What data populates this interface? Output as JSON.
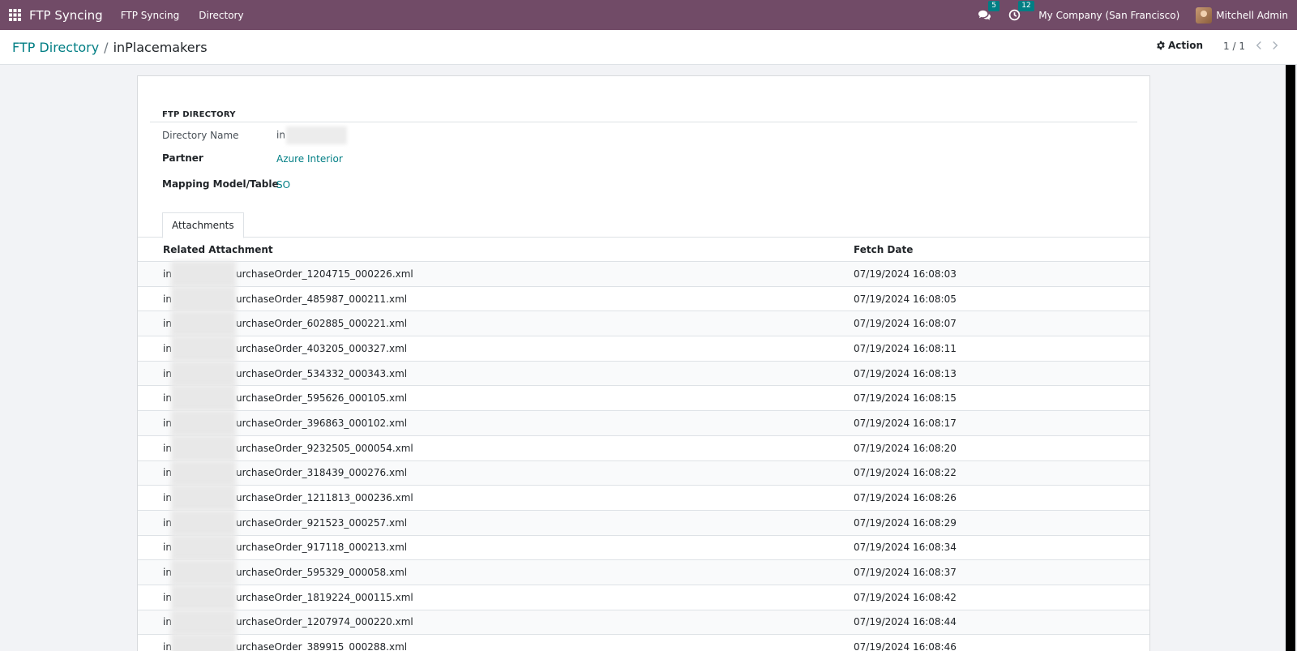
{
  "navbar": {
    "app_title": "FTP Syncing",
    "menu": [
      "FTP Syncing",
      "Directory"
    ],
    "messages_count": "5",
    "activities_count": "12",
    "company": "My Company (San Francisco)",
    "user": "Mitchell Admin"
  },
  "breadcrumb": {
    "parent": "FTP Directory",
    "separator": "/",
    "current": "inPlacemakers"
  },
  "control": {
    "action_label": "Action",
    "pager": "1 / 1"
  },
  "form": {
    "group_title": "FTP DIRECTORY",
    "directory_name_label": "Directory Name",
    "directory_name_value": "in",
    "partner_label": "Partner",
    "partner_value": "Azure Interior",
    "mapping_label": "Mapping Model/Table",
    "mapping_value": "SO"
  },
  "tabs": {
    "attachments": "Attachments"
  },
  "list": {
    "col_attachment": "Related Attachment",
    "col_date": "Fetch Date",
    "rows": [
      {
        "prefix": "in",
        "name": "urchaseOrder_1204715_000226.xml",
        "date": "07/19/2024 16:08:03"
      },
      {
        "prefix": "in",
        "name": "urchaseOrder_485987_000211.xml",
        "date": "07/19/2024 16:08:05"
      },
      {
        "prefix": "in",
        "name": "urchaseOrder_602885_000221.xml",
        "date": "07/19/2024 16:08:07"
      },
      {
        "prefix": "in",
        "name": "urchaseOrder_403205_000327.xml",
        "date": "07/19/2024 16:08:11"
      },
      {
        "prefix": "in",
        "name": "urchaseOrder_534332_000343.xml",
        "date": "07/19/2024 16:08:13"
      },
      {
        "prefix": "in",
        "name": "urchaseOrder_595626_000105.xml",
        "date": "07/19/2024 16:08:15"
      },
      {
        "prefix": "in",
        "name": "urchaseOrder_396863_000102.xml",
        "date": "07/19/2024 16:08:17"
      },
      {
        "prefix": "in",
        "name": "urchaseOrder_9232505_000054.xml",
        "date": "07/19/2024 16:08:20"
      },
      {
        "prefix": "in",
        "name": "urchaseOrder_318439_000276.xml",
        "date": "07/19/2024 16:08:22"
      },
      {
        "prefix": "in",
        "name": "urchaseOrder_1211813_000236.xml",
        "date": "07/19/2024 16:08:26"
      },
      {
        "prefix": "in",
        "name": "urchaseOrder_921523_000257.xml",
        "date": "07/19/2024 16:08:29"
      },
      {
        "prefix": "in",
        "name": "urchaseOrder_917118_000213.xml",
        "date": "07/19/2024 16:08:34"
      },
      {
        "prefix": "in",
        "name": "urchaseOrder_595329_000058.xml",
        "date": "07/19/2024 16:08:37"
      },
      {
        "prefix": "in",
        "name": "urchaseOrder_1819224_000115.xml",
        "date": "07/19/2024 16:08:42"
      },
      {
        "prefix": "in",
        "name": "urchaseOrder_1207974_000220.xml",
        "date": "07/19/2024 16:08:44"
      },
      {
        "prefix": "in",
        "name": "urchaseOrder_389915_000288.xml",
        "date": "07/19/2024 16:08:46"
      }
    ]
  }
}
